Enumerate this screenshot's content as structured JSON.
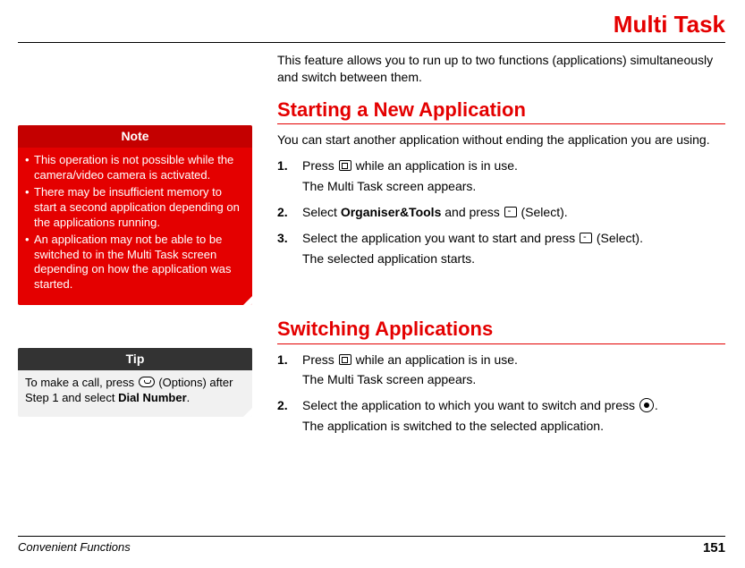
{
  "page_title": "Multi Task",
  "intro": "This feature allows you to run up to two functions (applications) simultaneously and switch between them.",
  "section1": {
    "title": "Starting a New Application",
    "lead": "You can start another application without ending the application you are using.",
    "steps": [
      {
        "num": "1.",
        "text_before": "Press ",
        "icon": "tab",
        "text_after": " while an application is in use.",
        "sub": "The Multi Task screen appears."
      },
      {
        "num": "2.",
        "text_before": "Select ",
        "bold1": "Organiser&Tools",
        "text_mid": " and press ",
        "icon": "dash",
        "text_after": " (Select)."
      },
      {
        "num": "3.",
        "text_before": "Select the application you want to start and press ",
        "icon": "dash",
        "text_after": " (Select).",
        "sub": "The selected application starts."
      }
    ]
  },
  "note": {
    "title": "Note",
    "items": [
      "This operation is not possible while the camera/video camera is activated.",
      "There may be insufficient memory to start a second application depending on the applications running.",
      "An application may not be able to be switched to in the Multi Task screen depending on how the application was started."
    ]
  },
  "section2": {
    "title": "Switching Applications",
    "steps": [
      {
        "num": "1.",
        "text_before": "Press ",
        "icon": "tab",
        "text_after": " while an application is in use.",
        "sub": "The Multi Task screen appears."
      },
      {
        "num": "2.",
        "text_before": "Select the application to which you want to switch and press ",
        "icon": "circle",
        "text_after": ".",
        "sub": "The application is switched to the selected application."
      }
    ]
  },
  "tip": {
    "title": "Tip",
    "text_before": "To make a call, press ",
    "icon": "rounded",
    "text_mid": " (Options) after Step 1 and select ",
    "bold": "Dial Number",
    "text_after": "."
  },
  "footer": {
    "left": "Convenient Functions",
    "right": "151"
  }
}
